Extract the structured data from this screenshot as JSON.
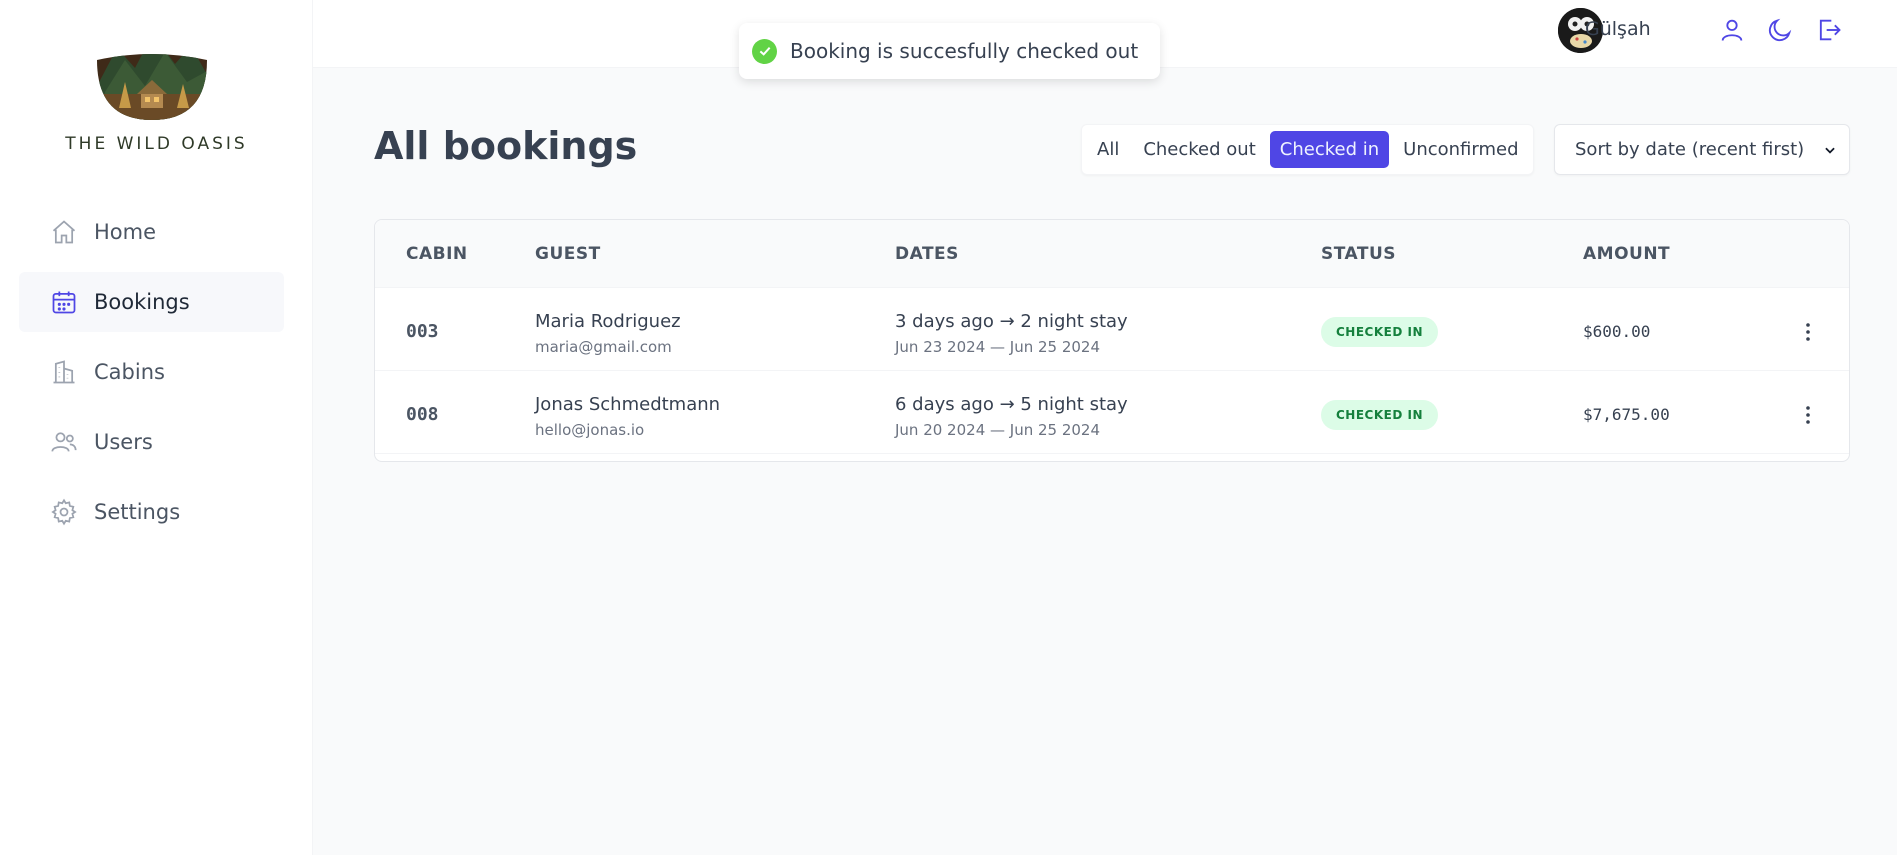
{
  "app": {
    "name": "THE WILD OASIS"
  },
  "sidebar": {
    "items": [
      {
        "label": "Home",
        "icon": "home-icon",
        "active": false
      },
      {
        "label": "Bookings",
        "icon": "calendar-icon",
        "active": true
      },
      {
        "label": "Cabins",
        "icon": "building-icon",
        "active": false
      },
      {
        "label": "Users",
        "icon": "users-icon",
        "active": false
      },
      {
        "label": "Settings",
        "icon": "gear-icon",
        "active": false
      }
    ]
  },
  "header": {
    "user_name": "Gülşah",
    "icons": [
      "user-icon",
      "moon-icon",
      "logout-icon"
    ]
  },
  "toast": {
    "message": "Booking is succesfully checked out",
    "icon": "check-circle-icon",
    "color": "#61d345"
  },
  "main": {
    "title": "All bookings",
    "filters": [
      {
        "label": "All",
        "active": false
      },
      {
        "label": "Checked out",
        "active": false
      },
      {
        "label": "Checked in",
        "active": true
      },
      {
        "label": "Unconfirmed",
        "active": false
      }
    ],
    "sort": {
      "selected": "Sort by date (recent first)"
    },
    "table": {
      "columns": [
        "CABIN",
        "GUEST",
        "DATES",
        "STATUS",
        "AMOUNT"
      ],
      "rows": [
        {
          "cabin": "003",
          "guest_name": "Maria Rodriguez",
          "guest_email": "maria@gmail.com",
          "dates_main": "3 days ago → 2 night stay",
          "dates_range": "Jun 23 2024 — Jun 25 2024",
          "status": "CHECKED IN",
          "amount": "$600.00"
        },
        {
          "cabin": "008",
          "guest_name": "Jonas Schmedtmann",
          "guest_email": "hello@jonas.io",
          "dates_main": "6 days ago → 5 night stay",
          "dates_range": "Jun 20 2024 — Jun 25 2024",
          "status": "CHECKED IN",
          "amount": "$7,675.00"
        }
      ]
    }
  },
  "colors": {
    "brand": "#4f46e5",
    "status_checked_in_bg": "#dcfce7",
    "status_checked_in_text": "#15803d"
  }
}
